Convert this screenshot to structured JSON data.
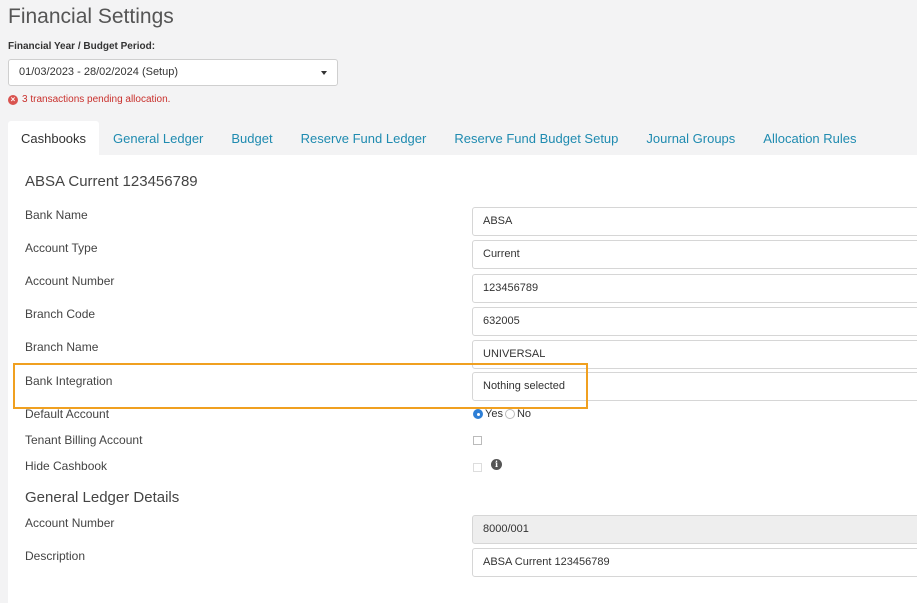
{
  "page": {
    "title": "Financial Settings"
  },
  "period": {
    "label": "Financial Year / Budget Period:",
    "selected": "01/03/2023 - 28/02/2024 (Setup)"
  },
  "alert": {
    "icon": "error-circle-icon",
    "text": "3 transactions pending allocation."
  },
  "tabs": [
    {
      "label": "Cashbooks",
      "active": true
    },
    {
      "label": "General Ledger"
    },
    {
      "label": "Budget"
    },
    {
      "label": "Reserve Fund Ledger"
    },
    {
      "label": "Reserve Fund Budget Setup"
    },
    {
      "label": "Journal Groups"
    },
    {
      "label": "Allocation Rules"
    }
  ],
  "cashbook": {
    "title": "ABSA Current 123456789",
    "fields": {
      "bank_name": {
        "label": "Bank Name",
        "value": "ABSA"
      },
      "account_type": {
        "label": "Account Type",
        "value": "Current"
      },
      "account_number": {
        "label": "Account Number",
        "value": "123456789"
      },
      "branch_code": {
        "label": "Branch Code",
        "value": "632005"
      },
      "branch_name": {
        "label": "Branch Name",
        "value": "UNIVERSAL"
      },
      "bank_integration": {
        "label": "Bank Integration",
        "value": "Nothing selected"
      },
      "default_account": {
        "label": "Default Account",
        "yes": "Yes",
        "no": "No",
        "selected": "Yes"
      },
      "tenant_billing": {
        "label": "Tenant Billing Account",
        "checked": false
      },
      "hide_cashbook": {
        "label": "Hide Cashbook",
        "checked": false,
        "info_icon": "info-icon"
      }
    }
  },
  "gl_details": {
    "title": "General Ledger Details",
    "account_number": {
      "label": "Account Number",
      "value": "8000/001"
    },
    "description": {
      "label": "Description",
      "value": "ABSA Current 123456789"
    }
  },
  "colors": {
    "tab_link": "#1f8bb0",
    "alert": "#c9302c",
    "highlight": "#f0a020",
    "radio_selected": "#2e7fd6"
  }
}
